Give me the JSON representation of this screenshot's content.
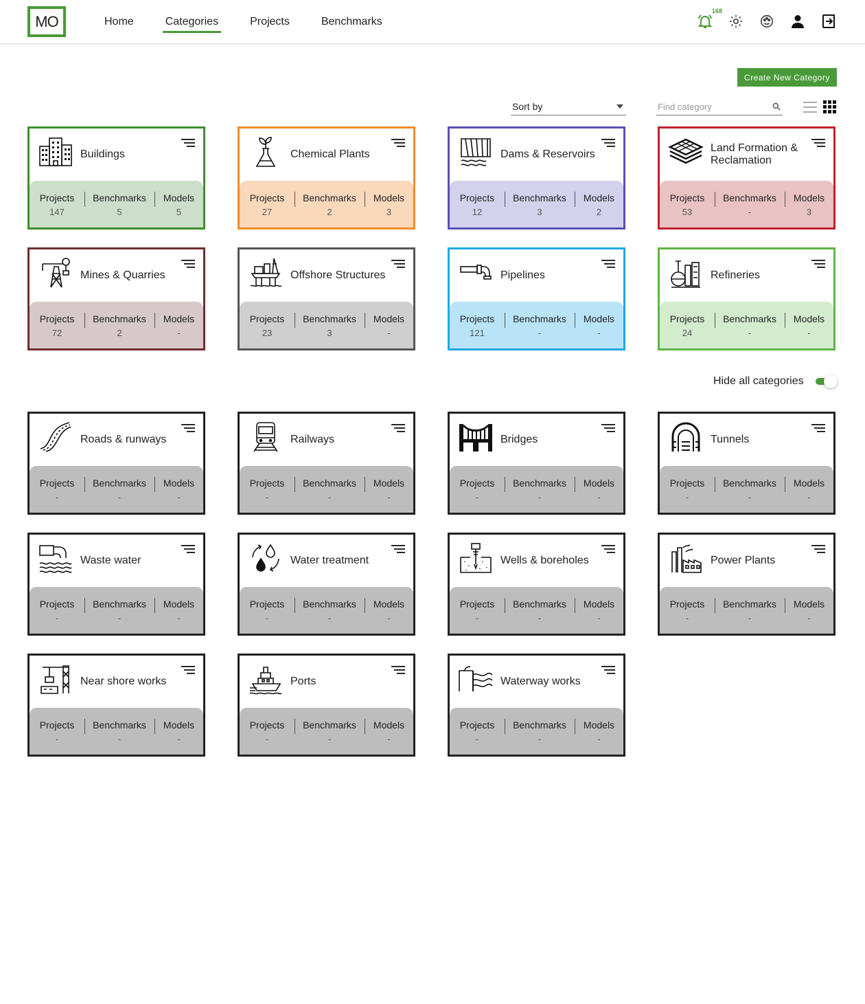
{
  "logo": {
    "text": "MO"
  },
  "nav": [
    {
      "label": "Home",
      "active": false
    },
    {
      "label": "Categories",
      "active": true
    },
    {
      "label": "Projects",
      "active": false
    },
    {
      "label": "Benchmarks",
      "active": false
    }
  ],
  "header_icons": {
    "notification_count": "168",
    "icons": [
      "bell-icon",
      "gear-icon",
      "palette-icon",
      "user-icon",
      "logout-icon"
    ],
    "accent_color": "#4a9a3a"
  },
  "toolbar": {
    "create_label": "Create New Category",
    "sort_label": "Sort by",
    "find_placeholder": "Find category"
  },
  "hide_all_label": "Hide all categories",
  "stat_labels": {
    "projects": "Projects",
    "benchmarks": "Benchmarks",
    "models": "Models"
  },
  "active_categories": [
    {
      "title": "Buildings",
      "icon": "buildings-icon",
      "color": "#3e8e2e",
      "bg": "#cddfcb",
      "projects": "147",
      "benchmarks": "5",
      "models": "5"
    },
    {
      "title": "Chemical Plants",
      "icon": "flask-plant-icon",
      "color": "#f08c2a",
      "bg": "#f9d8bc",
      "projects": "27",
      "benchmarks": "2",
      "models": "3"
    },
    {
      "title": "Dams & Reservoirs",
      "icon": "dam-icon",
      "color": "#5a4fb5",
      "bg": "#d3d1ec",
      "projects": "12",
      "benchmarks": "3",
      "models": "2"
    },
    {
      "title": "Land Formation & Reclamation",
      "icon": "layers-icon",
      "color": "#c21f2b",
      "bg": "#e9c2c4",
      "projects": "53",
      "benchmarks": "-",
      "models": "3"
    },
    {
      "title": "Mines & Quarries",
      "icon": "mine-tower-icon",
      "color": "#6e2e30",
      "bg": "#d7c8c9",
      "projects": "72",
      "benchmarks": "2",
      "models": "-"
    },
    {
      "title": "Offshore Structures",
      "icon": "offshore-platform-icon",
      "color": "#555555",
      "bg": "#cfcfcf",
      "projects": "23",
      "benchmarks": "3",
      "models": "-"
    },
    {
      "title": "Pipelines",
      "icon": "pipe-icon",
      "color": "#1fa9e3",
      "bg": "#b9e4f7",
      "projects": "121",
      "benchmarks": "-",
      "models": "-"
    },
    {
      "title": "Refineries",
      "icon": "refinery-icon",
      "color": "#5cb646",
      "bg": "#d4ecce",
      "projects": "24",
      "benchmarks": "-",
      "models": "-"
    }
  ],
  "hidden_categories": [
    {
      "title": "Roads & runways",
      "icon": "road-icon"
    },
    {
      "title": "Railways",
      "icon": "train-icon"
    },
    {
      "title": "Bridges",
      "icon": "bridge-icon"
    },
    {
      "title": "Tunnels",
      "icon": "tunnel-icon"
    },
    {
      "title": "Waste water",
      "icon": "waste-water-icon"
    },
    {
      "title": "Water treatment",
      "icon": "water-treatment-icon"
    },
    {
      "title": "Wells & boreholes",
      "icon": "well-icon"
    },
    {
      "title": "Power Plants",
      "icon": "power-plant-icon"
    },
    {
      "title": "Near shore works",
      "icon": "crane-icon"
    },
    {
      "title": "Ports",
      "icon": "ship-icon"
    },
    {
      "title": "Waterway works",
      "icon": "waterway-icon"
    }
  ],
  "hidden_style": {
    "color": "#222222",
    "bg": "#bdbdbd",
    "value": "-"
  }
}
